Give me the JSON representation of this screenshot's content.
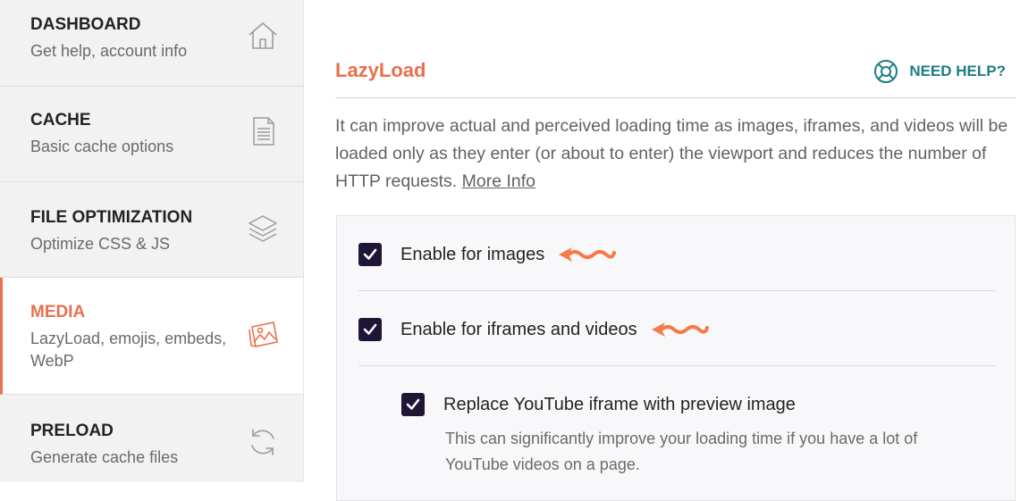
{
  "sidebar": {
    "items": [
      {
        "title": "DASHBOARD",
        "subtitle": "Get help, account info",
        "icon": "home-icon"
      },
      {
        "title": "CACHE",
        "subtitle": "Basic cache options",
        "icon": "document-icon"
      },
      {
        "title": "FILE OPTIMIZATION",
        "subtitle": "Optimize CSS & JS",
        "icon": "layers-icon"
      },
      {
        "title": "MEDIA",
        "subtitle": "LazyLoad, emojis, embeds, WebP",
        "icon": "images-icon",
        "active": true
      },
      {
        "title": "PRELOAD",
        "subtitle": "Generate cache files",
        "icon": "refresh-icon"
      }
    ]
  },
  "main": {
    "title": "LazyLoad",
    "help_label": "NEED HELP?",
    "description": "It can improve actual and perceived loading time as images, iframes, and videos will be loaded only as they enter (or about to enter) the viewport and reduces the number of HTTP requests.",
    "more_info": "More Info",
    "options": {
      "images": {
        "label": "Enable for images",
        "checked": true
      },
      "iframes": {
        "label": "Enable for iframes and videos",
        "checked": true
      },
      "youtube": {
        "label": "Replace YouTube iframe with preview image",
        "checked": true,
        "description": "This can significantly improve your loading time if you have a lot of YouTube videos on a page."
      }
    }
  },
  "colors": {
    "accent": "#e8704c",
    "teal": "#1d7d86",
    "checkbox": "#1f1536"
  }
}
